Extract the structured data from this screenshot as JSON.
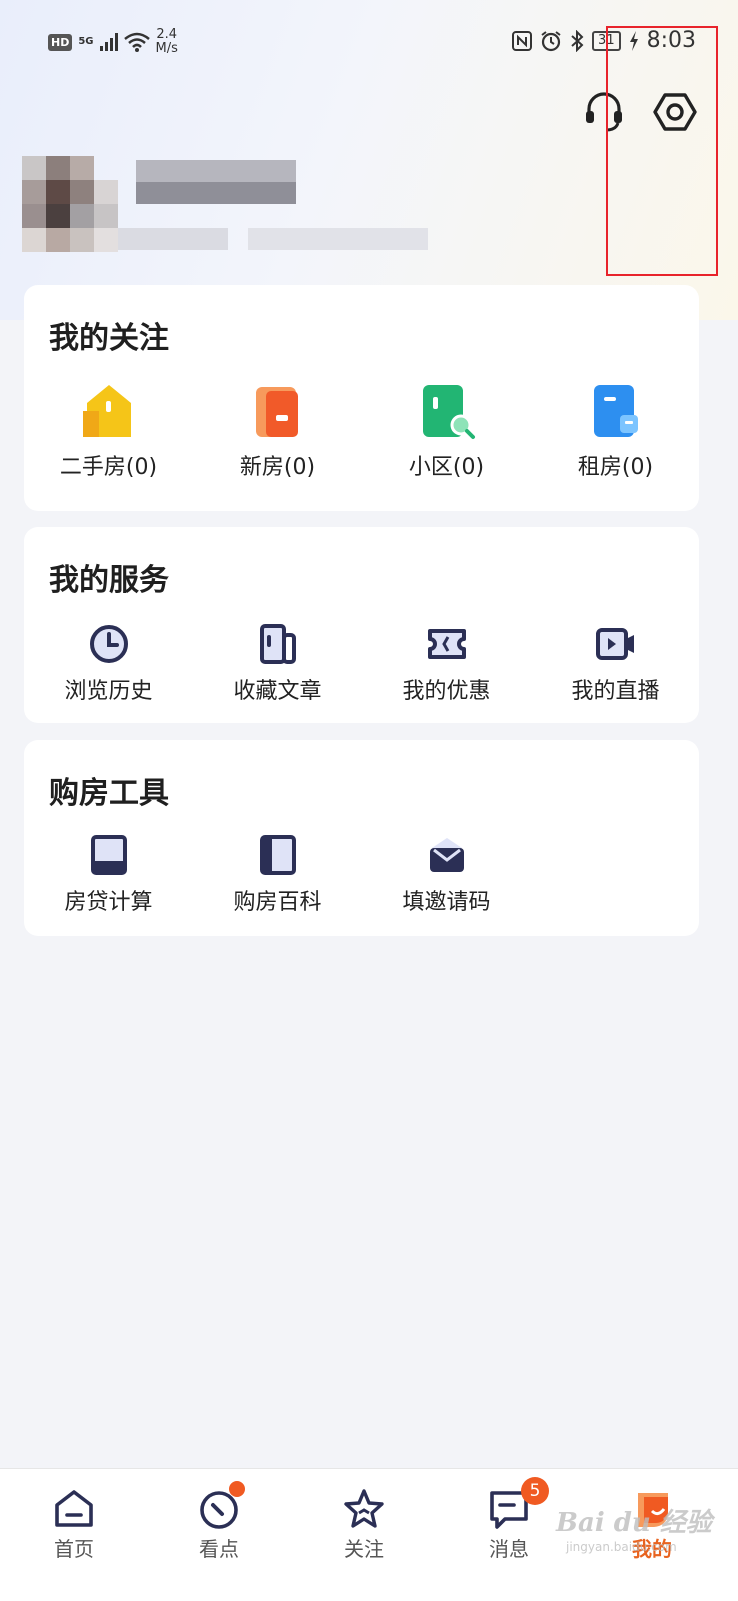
{
  "status_bar": {
    "hd": "HD",
    "network": "5G",
    "speed_top": "2.4",
    "speed_bottom": "M/s",
    "battery": "31",
    "time": "8:03"
  },
  "header": {
    "icons": [
      "customer-service-icon",
      "settings-icon"
    ]
  },
  "sections": {
    "follow": {
      "title": "我的关注",
      "items": [
        {
          "label": "二手房(0)",
          "icon": "second-hand-house-icon",
          "color": "#f5c518"
        },
        {
          "label": "新房(0)",
          "icon": "new-house-icon",
          "color": "#f15a29"
        },
        {
          "label": "小区(0)",
          "icon": "community-icon",
          "color": "#22b573"
        },
        {
          "label": "租房(0)",
          "icon": "rent-house-icon",
          "color": "#2d8ff0"
        }
      ]
    },
    "service": {
      "title": "我的服务",
      "items": [
        {
          "label": "浏览历史",
          "icon": "clock-icon"
        },
        {
          "label": "收藏文章",
          "icon": "article-icon"
        },
        {
          "label": "我的优惠",
          "icon": "ticket-icon"
        },
        {
          "label": "我的直播",
          "icon": "video-icon"
        }
      ]
    },
    "tools": {
      "title": "购房工具",
      "items": [
        {
          "label": "房贷计算",
          "icon": "calculator-icon"
        },
        {
          "label": "购房百科",
          "icon": "book-icon"
        },
        {
          "label": "填邀请码",
          "icon": "envelope-icon"
        }
      ]
    }
  },
  "bottom_nav": {
    "items": [
      {
        "label": "首页",
        "icon": "home-icon"
      },
      {
        "label": "看点",
        "icon": "compass-icon"
      },
      {
        "label": "关注",
        "icon": "star-icon"
      },
      {
        "label": "消息",
        "icon": "message-icon",
        "badge": "5"
      },
      {
        "label": "我的",
        "icon": "profile-icon"
      }
    ],
    "active_color": "#e8631f"
  },
  "watermark": {
    "text": "Bai du 经验",
    "sub": "jingyan.baidu.com"
  },
  "highlight_color": "#e8232b"
}
